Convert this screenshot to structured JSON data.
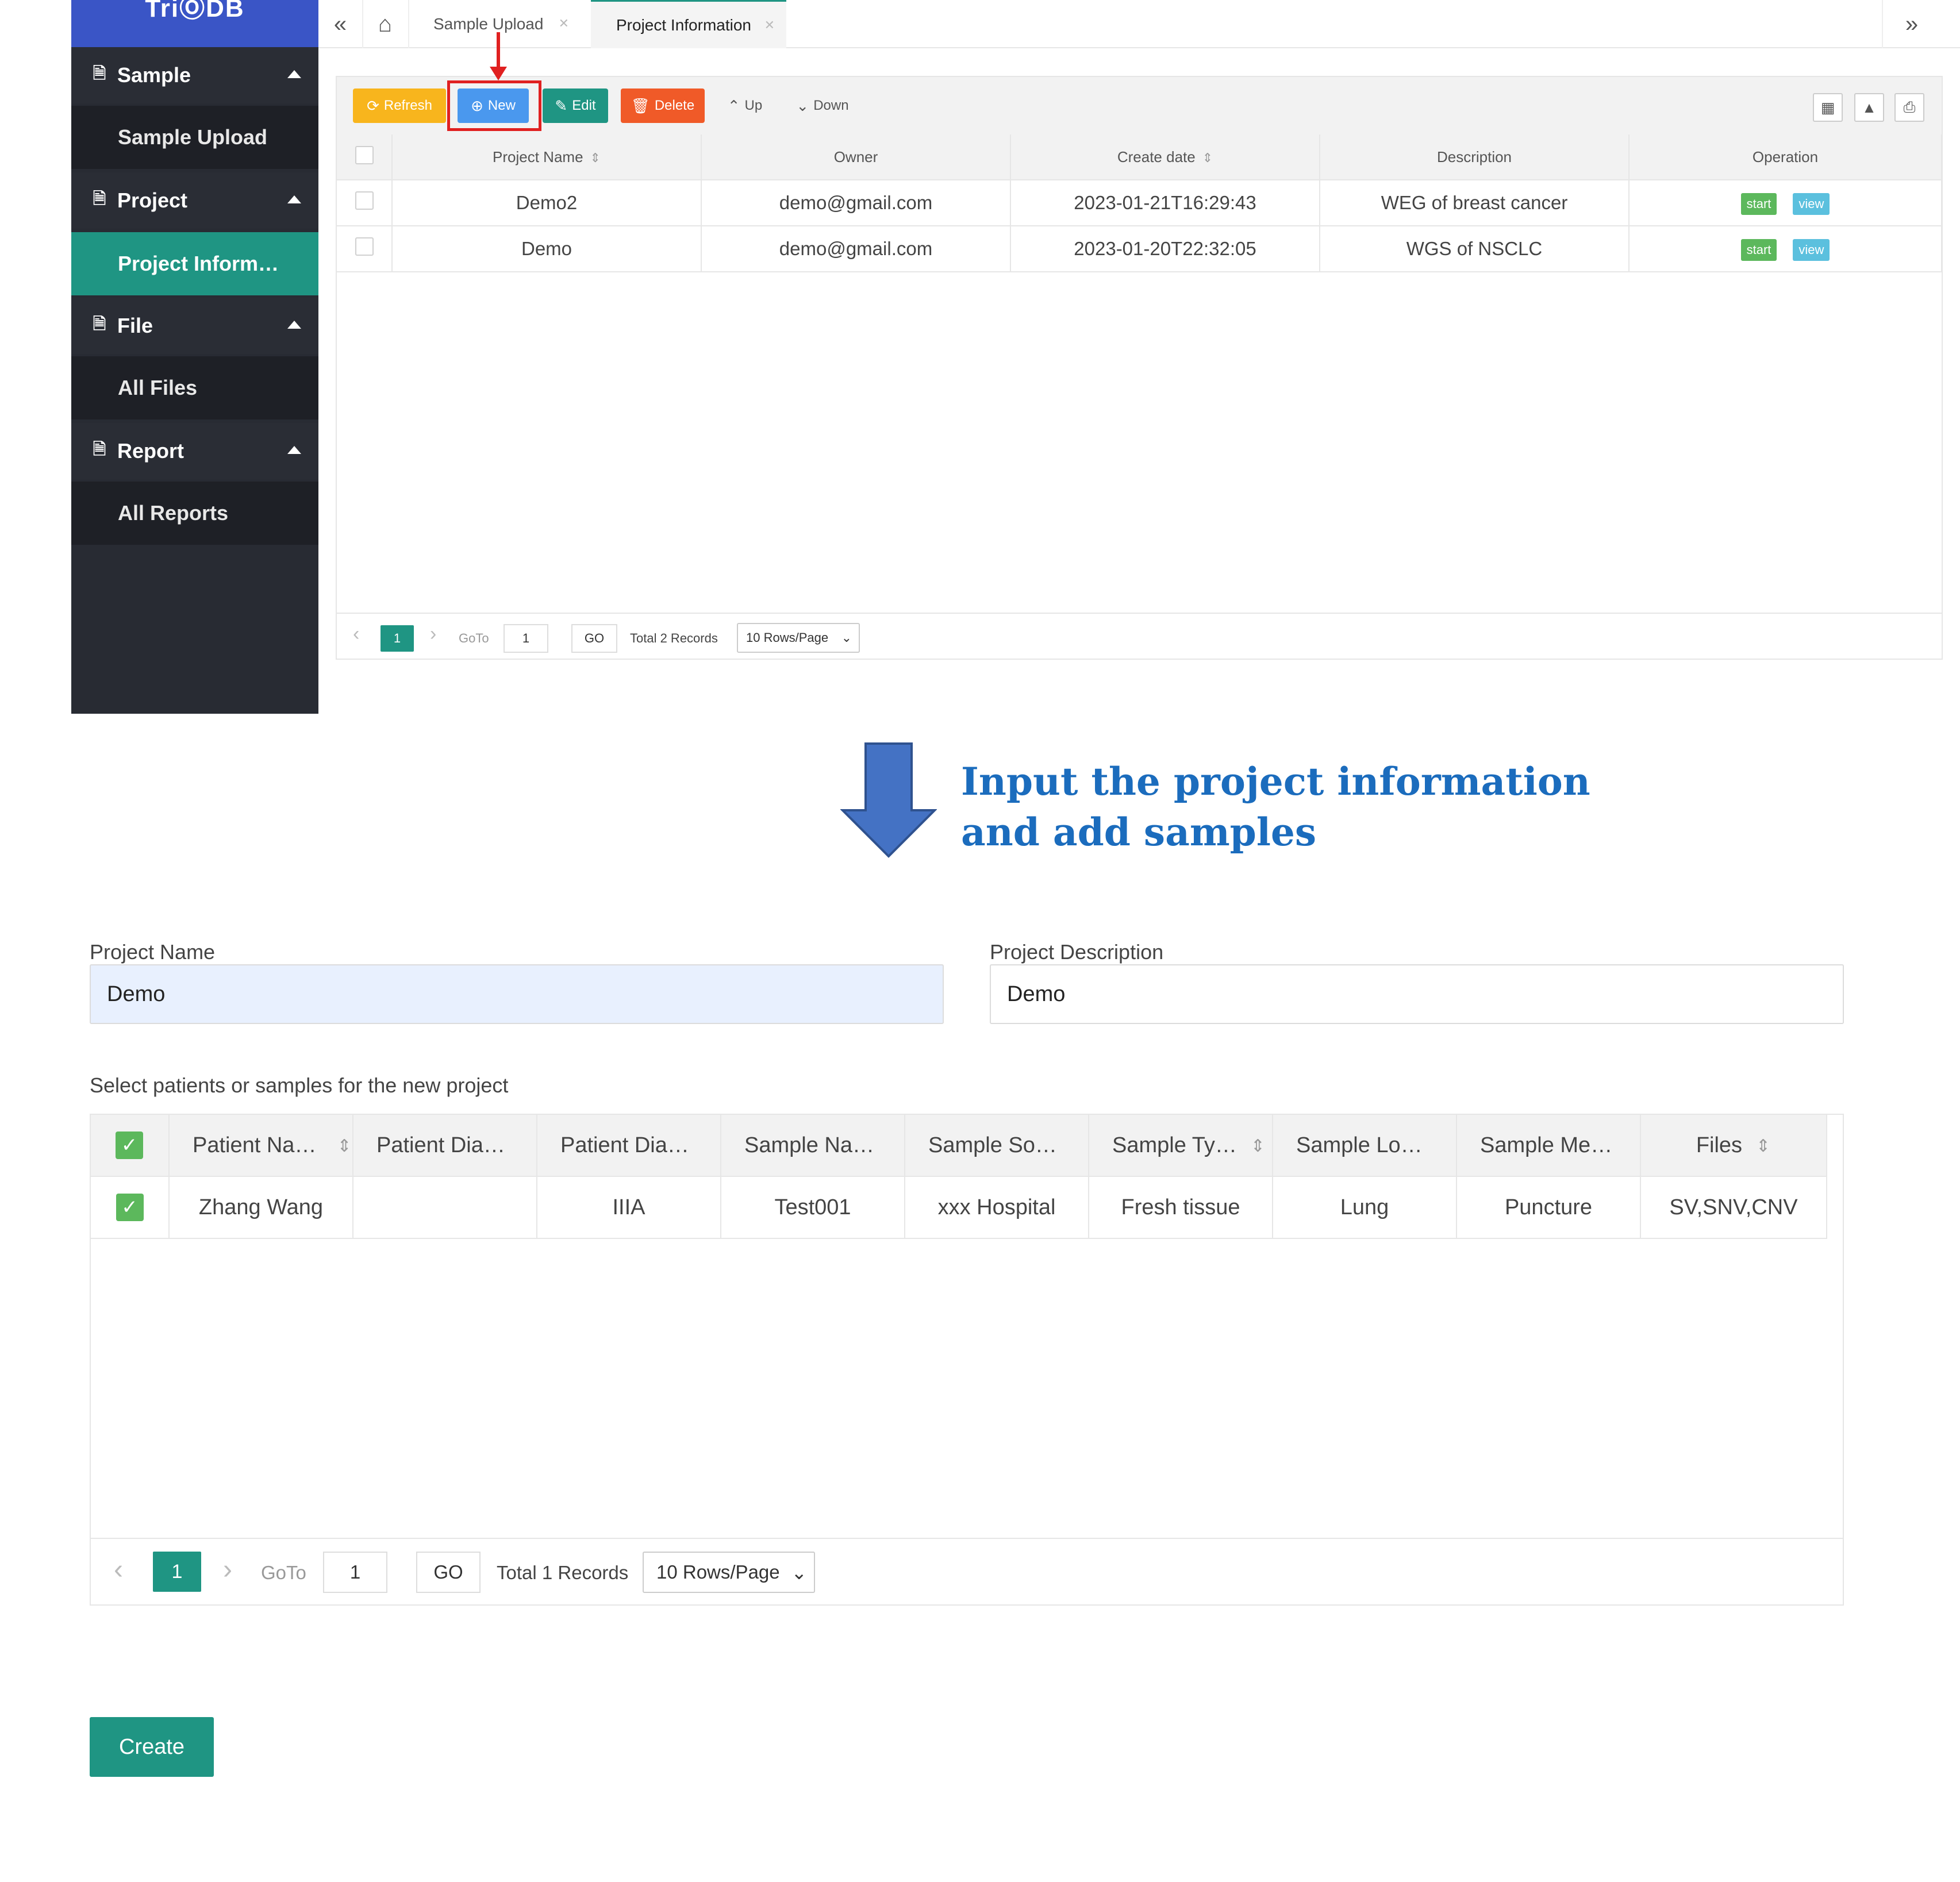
{
  "app": {
    "logo": "TriⓄDB"
  },
  "sidebar": {
    "groups": [
      {
        "label": "Sample",
        "item": "Sample Upload"
      },
      {
        "label": "Project",
        "item": "Project Inform…"
      },
      {
        "label": "File",
        "item": "All Files"
      },
      {
        "label": "Report",
        "item": "All Reports"
      }
    ]
  },
  "tabs": [
    {
      "label": "Sample Upload"
    },
    {
      "label": "Project Information"
    }
  ],
  "toolbar": {
    "refresh": "Refresh",
    "new": "New",
    "edit": "Edit",
    "delete": "Delete",
    "up": "Up",
    "down": "Down"
  },
  "colors": {
    "sidebar_bg": "#282b33",
    "accent": "#1f9583",
    "refresh": "#f8b51d",
    "new": "#4a98ee",
    "edit": "#1f9583",
    "delete": "#f05a28",
    "annotation_red": "#e02020",
    "annotation_blue": "#1b6cbd",
    "arrow_blue": "#4472c4"
  },
  "projects_table": {
    "columns": [
      "Project Name",
      "Owner",
      "Create date",
      "Description",
      "Operation"
    ],
    "rows": [
      {
        "name": "Demo2",
        "owner": "demo@gmail.com",
        "date": "2023-01-21T16:29:43",
        "description": "WEG of breast cancer",
        "start": "start",
        "view": "view"
      },
      {
        "name": "Demo",
        "owner": "demo@gmail.com",
        "date": "2023-01-20T22:32:05",
        "description": "WGS of NSCLC",
        "start": "start",
        "view": "view"
      }
    ]
  },
  "pager1": {
    "page": "1",
    "goto_label": "GoTo",
    "goto_value": "1",
    "go": "GO",
    "total": "Total 2 Records",
    "rows_per_page": "10 Rows/Page"
  },
  "caption": {
    "line1": "Input the project information",
    "line2": "and add samples"
  },
  "form": {
    "project_name_label": "Project Name",
    "project_name_value": "Demo",
    "project_desc_label": "Project Description",
    "project_desc_value": "Demo",
    "select_label": "Select patients or samples for the new project"
  },
  "samples_table": {
    "columns": [
      "Patient Na…",
      "Patient Dia…",
      "Patient Dia…",
      "Sample Na…",
      "Sample So…",
      "Sample Ty…",
      "Sample Lo…",
      "Sample Me…",
      "Files"
    ],
    "rows": [
      {
        "cells": [
          "Zhang Wang",
          "",
          "IIIA",
          "Test001",
          "xxx Hospital",
          "Fresh tissue",
          "Lung",
          "Puncture",
          "SV,SNV,CNV"
        ]
      }
    ]
  },
  "pager2": {
    "page": "1",
    "goto_label": "GoTo",
    "goto_value": "1",
    "go": "GO",
    "total": "Total 1 Records",
    "rows_per_page": "10 Rows/Page"
  },
  "create_button": "Create"
}
